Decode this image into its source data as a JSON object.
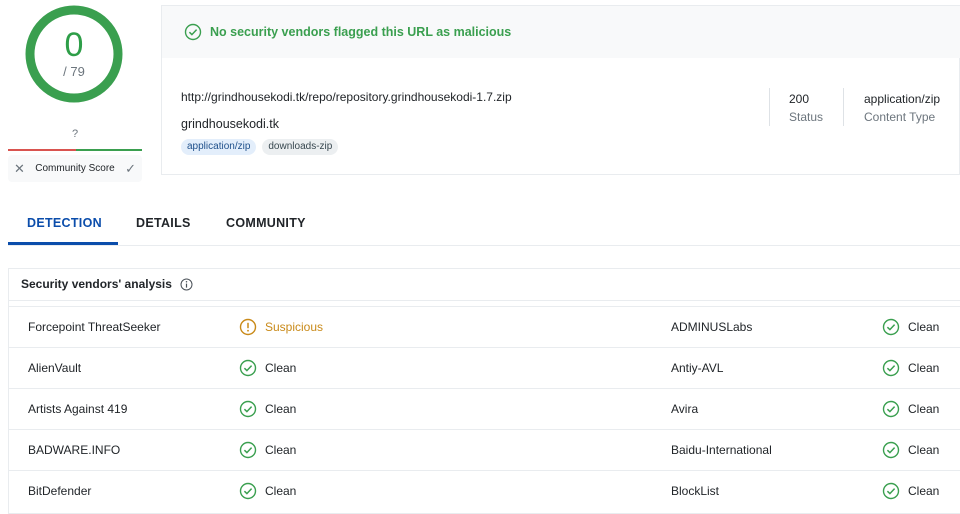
{
  "score": {
    "detections": "0",
    "total": "/ 79",
    "color": "#2e9e48"
  },
  "community": {
    "question": "?",
    "label": "Community Score"
  },
  "banner": {
    "text": "No security vendors flagged this URL as malicious",
    "color": "#3a9f4f"
  },
  "url_info": {
    "url": "http://grindhousekodi.tk/repo/repository.grindhousekodi-1.7.zip",
    "host": "grindhousekodi.tk",
    "tags": [
      "application/zip",
      "downloads-zip"
    ],
    "status_value": "200",
    "status_label": "Status",
    "content_type_value": "application/zip",
    "content_type_label": "Content Type"
  },
  "tabs": [
    {
      "label": "DETECTION",
      "active": true
    },
    {
      "label": "DETAILS",
      "active": false
    },
    {
      "label": "COMMUNITY",
      "active": false
    }
  ],
  "analysis": {
    "title": "Security vendors' analysis",
    "rows": [
      {
        "left_vendor": "Forcepoint ThreatSeeker",
        "left_result": "Suspicious",
        "left_icon": "suspicious-icon",
        "right_vendor": "ADMINUSLabs",
        "right_result": "Clean",
        "right_icon": "check-circle-icon"
      },
      {
        "left_vendor": "AlienVault",
        "left_result": "Clean",
        "left_icon": "check-circle-icon",
        "right_vendor": "Antiy-AVL",
        "right_result": "Clean",
        "right_icon": "check-circle-icon"
      },
      {
        "left_vendor": "Artists Against 419",
        "left_result": "Clean",
        "left_icon": "check-circle-icon",
        "right_vendor": "Avira",
        "right_result": "Clean",
        "right_icon": "check-circle-icon"
      },
      {
        "left_vendor": "BADWARE.INFO",
        "left_result": "Clean",
        "left_icon": "check-circle-icon",
        "right_vendor": "Baidu-International",
        "right_result": "Clean",
        "right_icon": "check-circle-icon"
      },
      {
        "left_vendor": "BitDefender",
        "left_result": "Clean",
        "left_icon": "check-circle-icon",
        "right_vendor": "BlockList",
        "right_result": "Clean",
        "right_icon": "check-circle-icon"
      }
    ]
  },
  "colors": {
    "clean": "#3a9f4f",
    "suspicious": "#c98a19",
    "accent": "#0b4dab"
  }
}
